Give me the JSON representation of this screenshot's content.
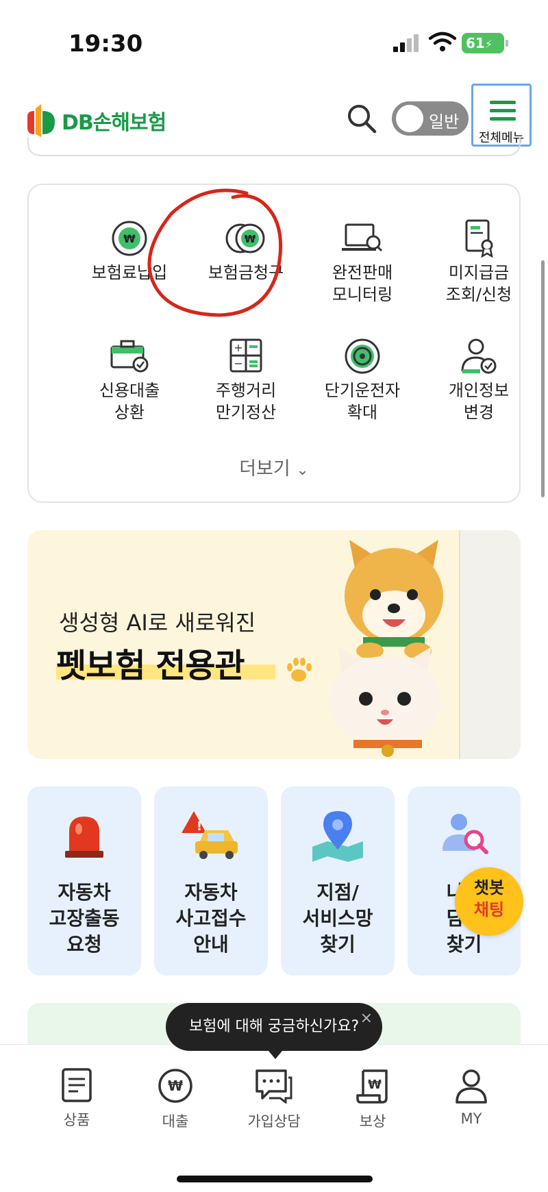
{
  "status_bar": {
    "time": "19:30",
    "battery": "61"
  },
  "header": {
    "logo_text": "DB손해보험",
    "mode_toggle_label": "일반",
    "menu_label": "전체메뉴"
  },
  "quick_menu": {
    "items": [
      {
        "label": "보험료납입",
        "icon": "won-coin-icon"
      },
      {
        "label": "보험금청구",
        "icon": "double-coin-icon"
      },
      {
        "label": "완전판매\n모니터링",
        "icon": "laptop-search-icon"
      },
      {
        "label": "미지급금\n조회/신청",
        "icon": "certificate-icon"
      },
      {
        "label": "신용대출\n상환",
        "icon": "briefcase-check-icon"
      },
      {
        "label": "주행거리\n만기정산",
        "icon": "calculator-icon"
      },
      {
        "label": "단기운전자\n확대",
        "icon": "steering-wheel-icon"
      },
      {
        "label": "개인정보\n변경",
        "icon": "user-check-icon"
      }
    ],
    "more_label": "더보기"
  },
  "banner": {
    "subtitle": "생성형 AI로 새로워진",
    "title": "펫보험 전용관"
  },
  "services": [
    {
      "label": "자동차\n고장출동\n요청",
      "icon": "siren-icon"
    },
    {
      "label": "자동차\n사고접수\n안내",
      "icon": "car-warning-icon"
    },
    {
      "label": "지점/\n서비스망\n찾기",
      "icon": "map-pin-icon"
    },
    {
      "label": "나의\n담당\n찾기",
      "icon": "person-search-icon"
    }
  ],
  "chatbot": {
    "line1": "챗봇",
    "line2": "채팅"
  },
  "tooltip": {
    "text": "보험에 대해 궁금하신가요?",
    "close": "×"
  },
  "tabbar": {
    "items": [
      {
        "label": "상품",
        "icon": "document-icon"
      },
      {
        "label": "대출",
        "icon": "won-circle-icon"
      },
      {
        "label": "가입상담",
        "icon": "chat-icon"
      },
      {
        "label": "보상",
        "icon": "receipt-icon"
      },
      {
        "label": "MY",
        "icon": "person-icon"
      }
    ]
  },
  "colors": {
    "brand_green": "#1a9a46",
    "chatbot_yellow": "#ffc21a",
    "annotation_red": "#d7261b"
  }
}
